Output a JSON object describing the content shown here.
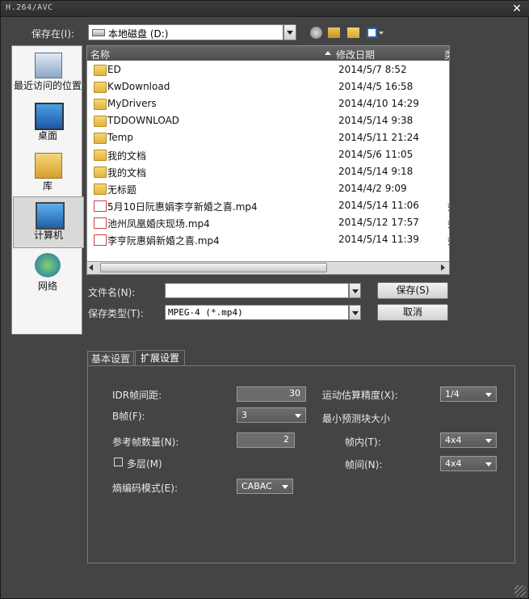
{
  "window": {
    "title": "H.264/AVC",
    "close": "✕"
  },
  "save_in": {
    "label": "保存在(I):",
    "value": "本地磁盘 (D:)"
  },
  "places": [
    {
      "label": "最近访问的位置"
    },
    {
      "label": "桌面"
    },
    {
      "label": "库"
    },
    {
      "label": "计算机"
    },
    {
      "label": "网络"
    }
  ],
  "list": {
    "col_name": "名称",
    "col_date": "修改日期",
    "col_extra": "类",
    "rows": [
      {
        "name": "ED",
        "date": "2014/5/7 8:52",
        "extra": "",
        "icon": "folder"
      },
      {
        "name": "KwDownload",
        "date": "2014/4/5 16:58",
        "extra": "",
        "icon": "folder"
      },
      {
        "name": "MyDrivers",
        "date": "2014/4/10 14:29",
        "extra": "",
        "icon": "folder"
      },
      {
        "name": "TDDOWNLOAD",
        "date": "2014/5/14 9:38",
        "extra": "",
        "icon": "folder"
      },
      {
        "name": "Temp",
        "date": "2014/5/11 21:24",
        "extra": "",
        "icon": "folder"
      },
      {
        "name": "我的文档",
        "date": "2014/5/6 11:05",
        "extra": "",
        "icon": "folder"
      },
      {
        "name": "我的文档",
        "date": "2014/5/14 9:18",
        "extra": "",
        "icon": "folder"
      },
      {
        "name": "无标题",
        "date": "2014/4/2 9:09",
        "extra": "",
        "icon": "folder"
      },
      {
        "name": "5月10日阮惠娟李亨新婚之喜.mp4",
        "date": "2014/5/14 11:06",
        "extra": "如",
        "icon": "mp4"
      },
      {
        "name": "池州凤凰婚庆现场.mp4",
        "date": "2014/5/12 17:57",
        "extra": "如",
        "icon": "mp4"
      },
      {
        "name": "李亨阮惠娟新婚之喜.mp4",
        "date": "2014/5/14 11:39",
        "extra": "如",
        "icon": "mp4"
      }
    ]
  },
  "filename": {
    "label": "文件名(N):",
    "value": ""
  },
  "filetype": {
    "label": "保存类型(T):",
    "value": "MPEG-4 (*.mp4)"
  },
  "buttons": {
    "save": "保存(S)",
    "cancel": "取消"
  },
  "tabs": {
    "basic": "基本设置",
    "advanced": "扩展设置"
  },
  "options": {
    "idr_label": "IDR帧间距:",
    "idr_value": "30",
    "bframe_label": "B帧(F):",
    "bframe_value": "3",
    "ref_label": "参考帧数量(N):",
    "ref_value": "2",
    "multilayer_label": "多层(M)",
    "entropy_label": "熵编码模式(E):",
    "entropy_value": "CABAC",
    "motion_label": "运动估算精度(X):",
    "motion_value": "1/4",
    "minblock_label": "最小预测块大小",
    "intra_label": "帧内(T):",
    "intra_value": "4x4",
    "inter_label": "帧间(N):",
    "inter_value": "4x4"
  }
}
